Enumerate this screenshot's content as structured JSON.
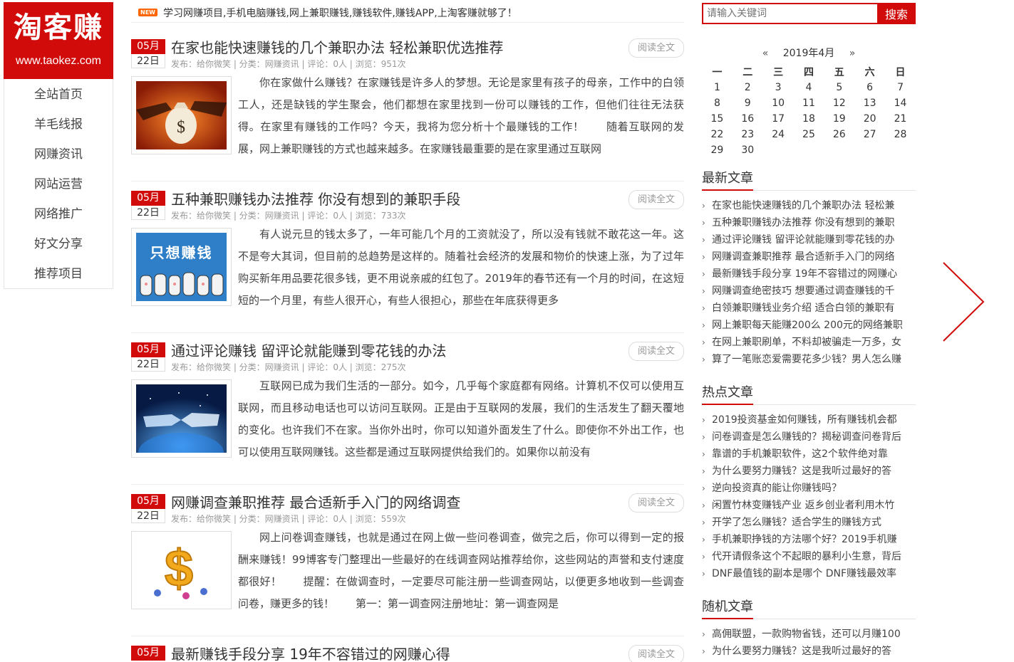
{
  "logo": {
    "name_cn": "淘客赚",
    "url_text": "www.taokez.com"
  },
  "nav": [
    "全站首页",
    "羊毛线报",
    "网赚资讯",
    "网站运营",
    "网络推广",
    "好文分享",
    "推荐项目"
  ],
  "notice": {
    "badge": "NEW",
    "text": "学习网赚项目,手机电脑赚钱,网上兼职赚钱,赚钱软件,赚钱APP,上淘客赚就够了！"
  },
  "search": {
    "placeholder": "请输入关键词",
    "button": "搜索"
  },
  "calendar": {
    "prev": "«",
    "month": "2019年4月",
    "next": "»",
    "weekdays": [
      "一",
      "二",
      "三",
      "四",
      "五",
      "六",
      "日"
    ],
    "weeks": [
      [
        "1",
        "2",
        "3",
        "4",
        "5",
        "6",
        "7"
      ],
      [
        "8",
        "9",
        "10",
        "11",
        "12",
        "13",
        "14"
      ],
      [
        "15",
        "16",
        "17",
        "18",
        "19",
        "20",
        "21"
      ],
      [
        "22",
        "23",
        "24",
        "25",
        "26",
        "27",
        "28"
      ],
      [
        "29",
        "30",
        "",
        "",
        "",
        "",
        ""
      ]
    ]
  },
  "read_more": "阅读全文",
  "articles": [
    {
      "month": "05月",
      "day": "22日",
      "title": "在家也能快速赚钱的几个兼职办法 轻松兼职优选推荐",
      "meta": "发布：给你微笑 | 分类：网赚资讯 | 评论：0人 | 浏览：951次",
      "excerpt": "你在家做什么赚钱？在家赚钱是许多人的梦想。无论是家里有孩子的母亲，工作中的白领工人，还是缺钱的学生聚会，他们都想在家里找到一份可以赚钱的工作，但他们往往无法获得。在家里有赚钱的工作吗？今天，我将为您分析十个最赚钱的工作！　　随着互联网的发展，网上兼职赚钱的方式也越来越多。在家赚钱最重要的是在家里通过互联网"
    },
    {
      "month": "05月",
      "day": "22日",
      "title": "五种兼职赚钱办法推荐 你没有想到的兼职手段",
      "meta": "发布：给你微笑 | 分类：网赚资讯 | 评论：0人 | 浏览：733次",
      "excerpt": "有人说元旦的钱太多了，一年可能几个月的工资就没了，所以没有钱就不敢花这一年。这不是夸大其词，但目前的总趋势是这样的。随着社会经济的发展和物价的快速上涨，为了过年购买新年用品要花很多钱，更不用说亲戚的红包了。2019年的春节还有一个月的时间，在这短短的一个月里，有些人很开心，有些人很担心，那些在年底获得更多"
    },
    {
      "month": "05月",
      "day": "22日",
      "title": "通过评论赚钱 留评论就能赚到零花钱的办法",
      "meta": "发布：给你微笑 | 分类：网赚资讯 | 评论：0人 | 浏览：275次",
      "excerpt": "互联网已成为我们生活的一部分。如今，几乎每个家庭都有网络。计算机不仅可以使用互联网，而且移动电话也可以访问互联网。正是由于互联网的发展，我们的生活发生了翻天覆地的变化。也许我们不在家。当你外出时，你可以知道外面发生了什么。即使你不外出工作，也可以使用互联网赚钱。这些都是通过互联网提供给我们的。如果你以前没有"
    },
    {
      "month": "05月",
      "day": "22日",
      "title": "网赚调查兼职推荐 最合适新手入门的网络调查",
      "meta": "发布：给你微笑 | 分类：网赚资讯 | 评论：0人 | 浏览：559次",
      "excerpt": "网上问卷调查赚钱，也就是通过在网上做一些问卷调查，做完之后，你可以得到一定的报酬来赚钱！99博客专门整理出一些最好的在线调查网站推荐给你，这些网站的声誉和支付速度都很好！　　提醒：在做调查时，一定要尽可能注册一些调查网站，以便更多地收到一些调查问卷，赚更多的钱！　　第一：第一调查网注册地址：第一调查网是"
    },
    {
      "month": "05月",
      "day": "",
      "title": "最新赚钱手段分享 19年不容错过的网赚心得",
      "meta": "",
      "excerpt": ""
    }
  ],
  "thumb_text": {
    "article2": "只想赚钱"
  },
  "latest": {
    "title": "最新文章",
    "items": [
      "在家也能快速赚钱的几个兼职办法 轻松兼",
      "五种兼职赚钱办法推荐 你没有想到的兼职",
      "通过评论赚钱 留评论就能赚到零花钱的办",
      "网赚调查兼职推荐 最合适新手入门的网络",
      "最新赚钱手段分享 19年不容错过的网赚心",
      "网赚调查绝密技巧 想要通过调查赚钱的千",
      "白领兼职赚钱业务介绍 适合白领的兼职有",
      "网上兼职每天能赚200么 200元的网络兼职",
      "在网上兼职刷单，不料却被骗走一万多，女",
      "算了一笔账恋爱需要花多少钱？男人怎么赚"
    ]
  },
  "hot": {
    "title": "热点文章",
    "items": [
      "2019投资基金如何赚钱，所有赚钱机会都",
      "问卷调查是怎么赚钱的？揭秘调查问卷背后",
      "靠谱的手机兼职软件，这2个软件绝对靠",
      "为什么要努力赚钱？这是我听过最好的答",
      "逆向投资真的能让你赚钱吗？",
      "闲置竹林变赚钱产业 返乡创业者利用木竹",
      "开学了怎么赚钱？适合学生的赚钱方式",
      "手机兼职挣钱的方法哪个好？2019手机赚",
      "代开请假条这个不起眼的暴利小生意，背后",
      "DNF最值钱的副本是哪个 DNF赚钱最效率"
    ]
  },
  "random": {
    "title": "随机文章",
    "items": [
      "高佣联盟，一款购物省钱，还可以月赚100",
      "为什么要努力赚钱？这是我听过最好的答"
    ]
  },
  "colors": {
    "accent": "#d10a0a",
    "text": "#333333",
    "meta": "#999999"
  },
  "icons": {
    "next": "chevron-right-icon",
    "bullet": "chevron-right-small-icon"
  }
}
